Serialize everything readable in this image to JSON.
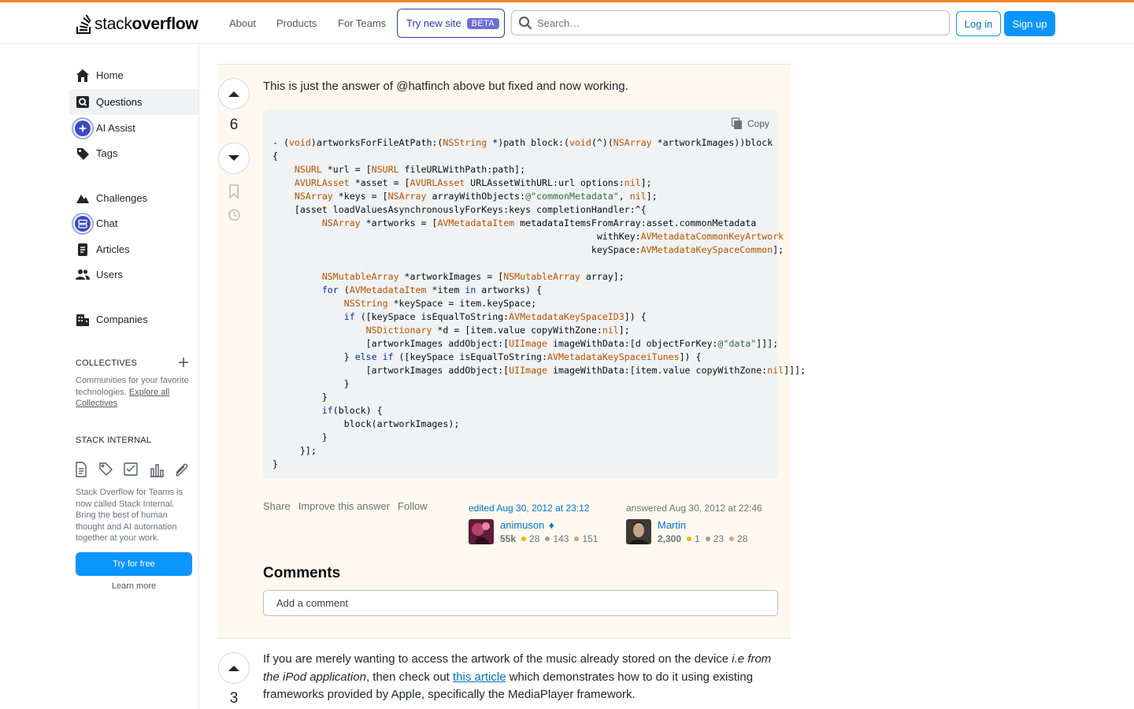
{
  "brand": {
    "logo_text_1": "stack",
    "logo_text_2": "overflow",
    "accent": "#f48225",
    "primary": "#0a95ff"
  },
  "topnav": {
    "about": "About",
    "products": "Products",
    "for_teams": "For Teams",
    "try_new_site": "Try new site",
    "beta": "BETA",
    "search_placeholder": "Search…",
    "login": "Log in",
    "signup": "Sign up"
  },
  "sidebar": {
    "items": [
      {
        "label": "Home",
        "icon": "home-icon"
      },
      {
        "label": "Questions",
        "icon": "questions-icon",
        "active": true
      },
      {
        "label": "AI Assist",
        "icon": "ai-assist-icon"
      },
      {
        "label": "Tags",
        "icon": "tag-icon"
      },
      {
        "label": "Challenges",
        "icon": "challenges-icon"
      },
      {
        "label": "Chat",
        "icon": "chat-icon"
      },
      {
        "label": "Articles",
        "icon": "articles-icon"
      },
      {
        "label": "Users",
        "icon": "users-icon"
      },
      {
        "label": "Companies",
        "icon": "companies-icon"
      }
    ],
    "collectives_heading": "COLLECTIVES",
    "collectives_text": "Communities for your favorite technologies.",
    "collectives_link": "Explore all Collectives",
    "stack_internal_heading": "STACK INTERNAL",
    "stack_internal_text": "Stack Overflow for Teams is now called Stack Internal. Bring the best of human thought and AI automation together at your work.",
    "try_free": "Try for free",
    "learn_more": "Learn more"
  },
  "answer1": {
    "score": "6",
    "lead": "This is just the answer of @hatfinch above but fixed and now working.",
    "copy_label": "Copy",
    "code_lines": [
      "- (void)artworksForFileAtPath:(NSString *)path block:(void(^)(NSArray *artworkImages))block",
      "{",
      "    NSURL *url = [NSURL fileURLWithPath:path];",
      "    AVURLAsset *asset = [AVURLAsset URLAssetWithURL:url options:nil];",
      "    NSArray *keys = [NSArray arrayWithObjects:@\"commonMetadata\", nil];",
      "    [asset loadValuesAsynchronouslyForKeys:keys completionHandler:^{",
      "         NSArray *artworks = [AVMetadataItem metadataItemsFromArray:asset.commonMetadata",
      "                                                           withKey:AVMetadataCommonKeyArtwork",
      "                                                          keySpace:AVMetadataKeySpaceCommon];",
      "",
      "         NSMutableArray *artworkImages = [NSMutableArray array];",
      "         for (AVMetadataItem *item in artworks) {",
      "             NSString *keySpace = item.keySpace;",
      "             if ([keySpace isEqualToString:AVMetadataKeySpaceID3]) {",
      "                 NSDictionary *d = [item.value copyWithZone:nil];",
      "                 [artworkImages addObject:[UIImage imageWithData:[d objectForKey:@\"data\"]]];",
      "             } else if ([keySpace isEqualToString:AVMetadataKeySpaceiTunes]) {",
      "                 [artworkImages addObject:[UIImage imageWithData:[item.value copyWithZone:nil]]];",
      "             }",
      "         }",
      "         if(block) {",
      "             block(artworkImages);",
      "         }",
      "     }];",
      "}"
    ],
    "menu": {
      "share": "Share",
      "improve": "Improve this answer",
      "follow": "Follow"
    },
    "editor": {
      "action": "edited Aug 30, 2012 at 23:12",
      "name": "animuson",
      "diamond": "♦",
      "rep": "55k",
      "gold": "28",
      "silver": "143",
      "bronze": "151"
    },
    "author": {
      "action": "answered Aug 30, 2012 at 22:46",
      "name": "Martin",
      "rep": "2,300",
      "gold": "1",
      "silver": "23",
      "bronze": "28"
    },
    "comments_heading": "Comments",
    "comment_placeholder": "Add a comment"
  },
  "answer2": {
    "score": "3",
    "text_1": "If you are merely wanting to access the artwork of the music already stored on the device ",
    "text_italic": "i.e from the iPod application",
    "text_2": ", then check out ",
    "link": "this article",
    "text_3": " which demonstrates how to do it using existing frameworks provided by Apple, specifically the MediaPlayer framework."
  }
}
